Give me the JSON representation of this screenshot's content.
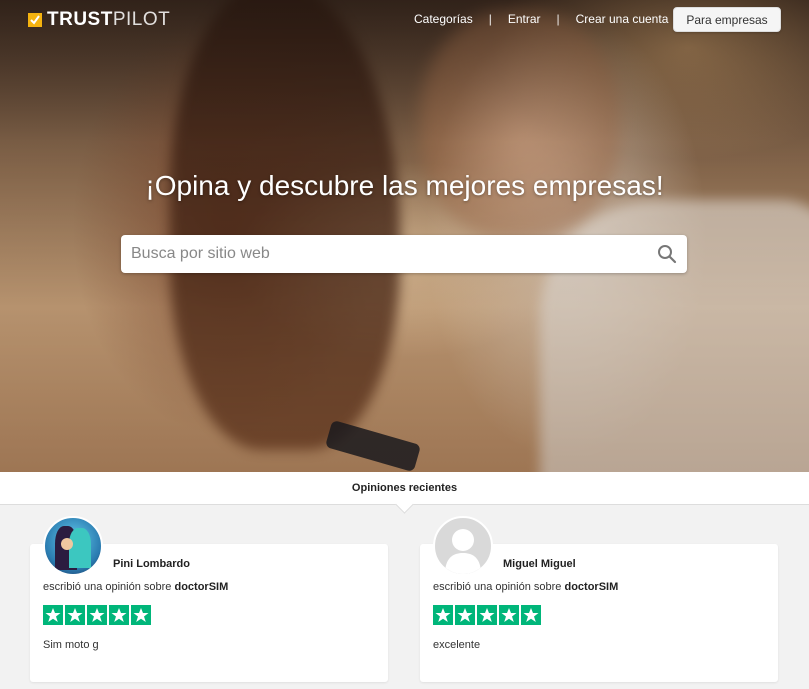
{
  "header": {
    "logo_part1": "TRUST",
    "logo_part2": "PILOT",
    "nav": [
      "Categorías",
      "Entrar",
      "Crear una cuenta"
    ],
    "separator": "|",
    "business_button": "Para empresas"
  },
  "hero": {
    "headline": "¡Opina y descubre las mejores empresas!",
    "search_placeholder": "Busca por sitio web",
    "search_icon": "search-icon"
  },
  "recent": {
    "title": "Opiniones recientes",
    "reviews": [
      {
        "name": "Pini Lombardo",
        "wrote_prefix": "escribió una opinión sobre",
        "company": "doctorSIM",
        "stars": 5,
        "text": "Sim moto g"
      },
      {
        "name": "Miguel Miguel",
        "wrote_prefix": "escribió una opinión sobre",
        "company": "doctorSIM",
        "stars": 5,
        "text": "excelente"
      }
    ]
  },
  "colors": {
    "star_green": "#00b67a",
    "logo_accent": "#f5b30f"
  }
}
